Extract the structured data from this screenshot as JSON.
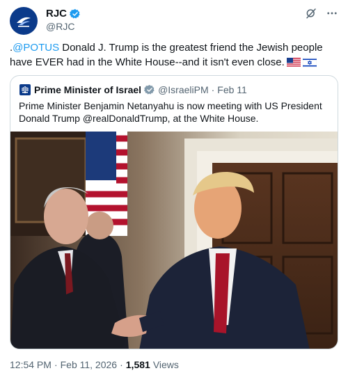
{
  "author": {
    "display_name": "RJC",
    "handle": "@RJC",
    "verified": true,
    "avatar_icon": "rjc-logo-icon",
    "brand_color": "#0b3a8a"
  },
  "header_actions": {
    "grok_icon": "grok-icon",
    "more_icon": "more-options-icon"
  },
  "tweet": {
    "prefix": ".",
    "mention": "@POTUS",
    "text": " Donald J. Trump is the greatest friend the Jewish people have EVER had in the White House--and it isn't even close.",
    "flags": [
      "us-flag-icon",
      "israel-flag-icon"
    ]
  },
  "quote": {
    "display_name": "Prime Minister of Israel",
    "handle": "@IsraeliPM",
    "separator": "·",
    "date": "Feb 11",
    "affiliation_badge": "israel-emblem-icon",
    "verified_color": "#829aab",
    "text": "Prime Minister Benjamin Netanyahu is now meeting with US President Donald Trump @realDonaldTrump, at the White House.",
    "photo": "meeting-photo"
  },
  "meta": {
    "time": "12:54 PM",
    "separator": "·",
    "date": "Feb 11, 2026",
    "separator2": "·",
    "views_count": "1,581",
    "views_label": "Views"
  },
  "colors": {
    "link": "#1d9bf0",
    "verified": "#1d9bf0",
    "muted": "#536471",
    "border": "#cfd9de"
  }
}
